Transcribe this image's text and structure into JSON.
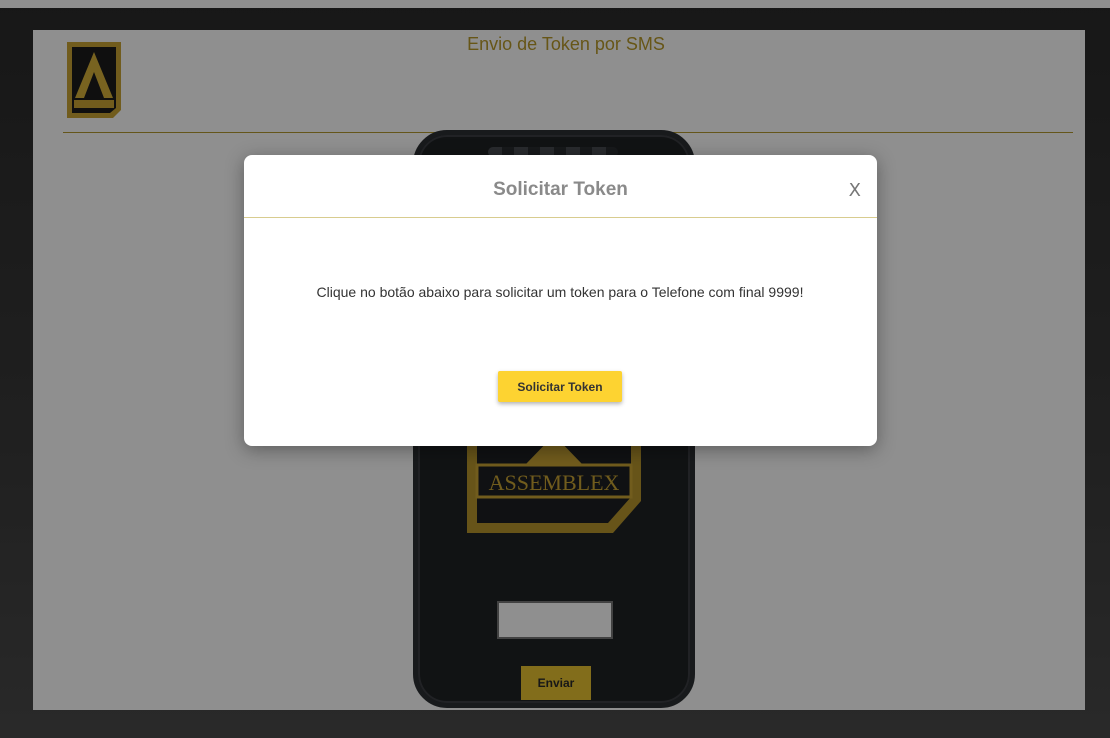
{
  "header": {
    "title": "Envio de Token por SMS"
  },
  "phone": {
    "logo_text": "ASSEMBLEX",
    "send_label": "Enviar",
    "token_input_value": ""
  },
  "modal": {
    "title": "Solicitar Token",
    "close_label": "X",
    "message": "Clique no botão abaixo para solicitar um token para o Telefone com final 9999!",
    "button_label": "Solicitar Token"
  },
  "colors": {
    "accent_gold": "#e8c331",
    "button_yellow": "#fdd331"
  }
}
